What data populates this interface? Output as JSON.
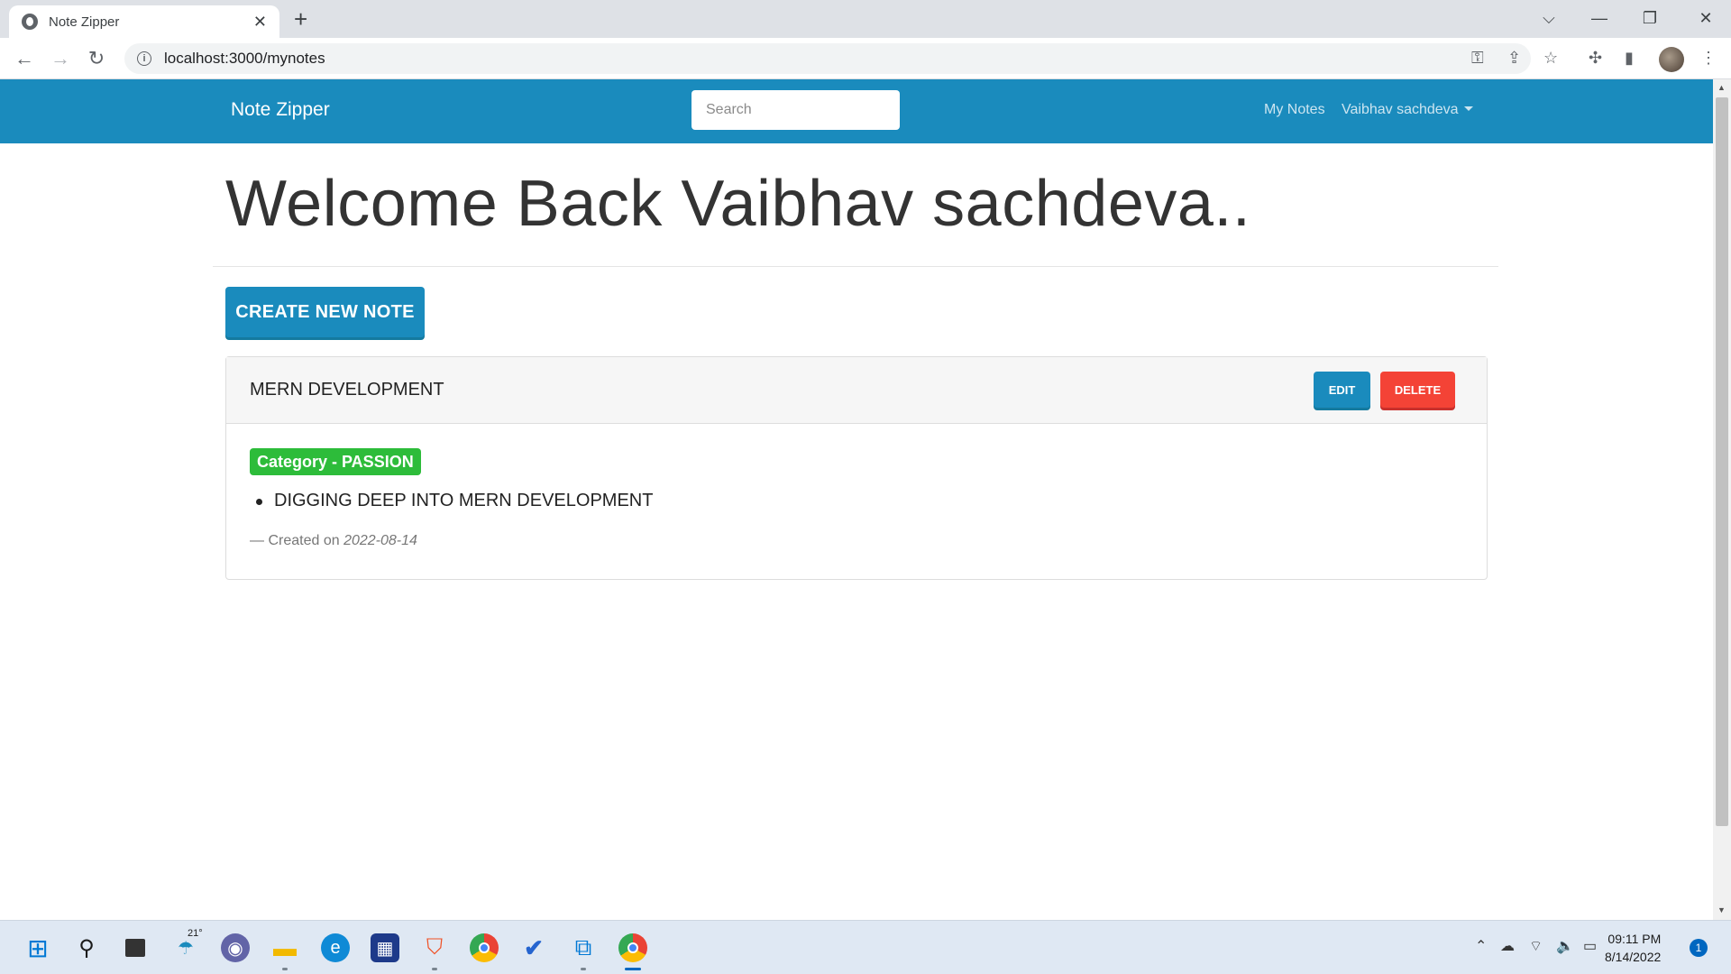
{
  "browser": {
    "tab_title": "Note Zipper",
    "new_tab_symbol": "+",
    "url": "localhost:3000/mynotes"
  },
  "navbar": {
    "brand": "Note Zipper",
    "search_placeholder": "Search",
    "my_notes": "My Notes",
    "user_name": "Vaibhav sachdeva"
  },
  "main": {
    "welcome": "Welcome Back Vaibhav sachdeva..",
    "create_button": "CREATE NEW NOTE"
  },
  "notes": [
    {
      "title": "MERN DEVELOPMENT",
      "edit_label": "EDIT",
      "delete_label": "DELETE",
      "category": "Category - PASSION",
      "content": "DIGGING DEEP INTO MERN DEVELOPMENT",
      "created_prefix": "— Created on",
      "created_date": "2022-08-14"
    }
  ],
  "taskbar": {
    "weather": "21°",
    "time": "09:11 PM",
    "date": "8/14/2022",
    "notification_count": "1"
  },
  "colors": {
    "primary": "#1a8bbd",
    "danger": "#f44336",
    "success": "#2dbc3a"
  }
}
